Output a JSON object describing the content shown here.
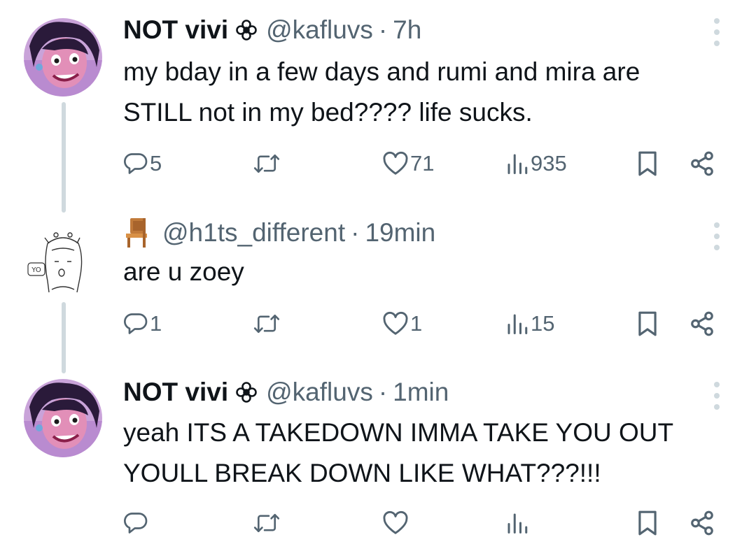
{
  "posts": [
    {
      "display_name": "NOT vivi",
      "name_icon": "flower-icon",
      "handle": "@kafluvs",
      "separator": "·",
      "time": "7h",
      "text": "my bday in a few days and rumi and mira are\nSTILL not in my bed???? life sucks.",
      "stats": {
        "replies": "5",
        "reposts": "",
        "likes": "71",
        "views": "935"
      }
    },
    {
      "display_name": "",
      "name_icon": "chair-icon",
      "handle": "@h1ts_different",
      "separator": "·",
      "time": "19min",
      "text": "are u zoey",
      "avatar_text": "YO",
      "stats": {
        "replies": "1",
        "reposts": "",
        "likes": "1",
        "views": "15"
      }
    },
    {
      "display_name": "NOT vivi",
      "name_icon": "flower-icon",
      "handle": "@kafluvs",
      "separator": "·",
      "time": "1min",
      "text": "yeah ITS A TAKEDOWN IMMA TAKE YOU OUT\nYOULL BREAK DOWN LIKE WHAT???!!!",
      "stats": {
        "replies": "",
        "reposts": "",
        "likes": "",
        "views": ""
      }
    }
  ],
  "colors": {
    "text": "#0f1419",
    "muted": "#536471",
    "thread_line": "#cfd9de",
    "background": "#ffffff"
  }
}
